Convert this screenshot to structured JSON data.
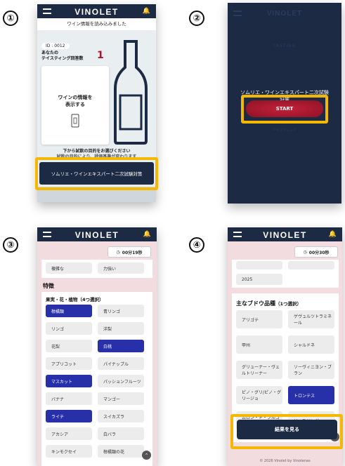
{
  "steps": [
    "①",
    "②",
    "③",
    "④"
  ],
  "app": {
    "logo": "VINOLET",
    "menu_icon": "hamburger-icon",
    "bell_icon": "bell-icon"
  },
  "screen1": {
    "banner": "ワイン情報を読み込みました",
    "id_badge": "ID : 0012",
    "tasting_label_line1": "あなたの",
    "tasting_label_line2": "テイスティング回答数",
    "tasting_count": "1",
    "card_line1": "ワインの情報を",
    "card_line2": "表示する",
    "prompt_line1": "下から試飲の目的をお選びください",
    "prompt_line2": "試飲の目的により、評価基準が変わります",
    "purpose_button": "ソムリエ・ワインエキスパート二次試験対策"
  },
  "screen2": {
    "header_faint": "VINOLET",
    "tasting_faint": "TASTING",
    "title_line1": "ソムリエ・ワインエキスパート二次試",
    "title_line2": "験",
    "title_line3": "対策",
    "start_button": "START",
    "sub_faint": "テイスティング"
  },
  "screen3": {
    "timer": "00分19秒",
    "top_options": [
      "複雑な",
      "力強い"
    ],
    "section_title": "特徴",
    "group_title": "果実・花・植物（4つ選択）",
    "options": [
      {
        "label": "柑橘類",
        "selected": true
      },
      {
        "label": "青リンゴ",
        "selected": false
      },
      {
        "label": "リンゴ",
        "selected": false
      },
      {
        "label": "洋梨",
        "selected": false
      },
      {
        "label": "花梨",
        "selected": false
      },
      {
        "label": "白桃",
        "selected": true
      },
      {
        "label": "アプリコット",
        "selected": false
      },
      {
        "label": "パイナップル",
        "selected": false
      },
      {
        "label": "マスカット",
        "selected": true
      },
      {
        "label": "パッションフルーツ",
        "selected": false
      },
      {
        "label": "バナナ",
        "selected": false
      },
      {
        "label": "マンゴー",
        "selected": false
      },
      {
        "label": "ライチ",
        "selected": true
      },
      {
        "label": "スイカズラ",
        "selected": false
      },
      {
        "label": "アカシア",
        "selected": false
      },
      {
        "label": "白バラ",
        "selected": false
      },
      {
        "label": "キンモクセイ",
        "selected": false
      },
      {
        "label": "柑橘類の花",
        "selected": false
      }
    ]
  },
  "screen4": {
    "timer": "00分30秒",
    "year_option": "2025",
    "section_title": "主なブドウ品種",
    "section_hint": "（1つ選択）",
    "options": [
      {
        "label": "アリゴテ",
        "selected": false
      },
      {
        "label": "ゲヴュルツトラミネール",
        "selected": false
      },
      {
        "label": "甲州",
        "selected": false
      },
      {
        "label": "シャルドネ",
        "selected": false
      },
      {
        "label": "グリューナー・ヴェルトリーナー",
        "selected": false
      },
      {
        "label": "ソーヴィニヨン・ブラン",
        "selected": false
      },
      {
        "label": "ピノ・グリ/ピノ・グリージョ",
        "selected": false
      },
      {
        "label": "トロンテス",
        "selected": true
      },
      {
        "label": "ムロン・ド・ブルゴーニュ（ミュスカ...",
        "selected": false
      },
      {
        "label": "リースリング",
        "selected": false
      }
    ],
    "result_button": "結果を見る",
    "footer": "© 2026 Vinolet by Vinotenas"
  },
  "colors": {
    "navy": "#1c2a44",
    "highlight": "#f5b800",
    "selected": "#2730a8",
    "start": "#a8162a"
  }
}
